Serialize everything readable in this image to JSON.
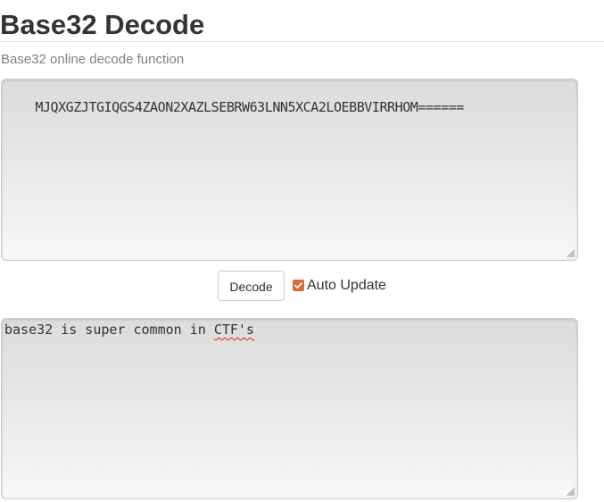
{
  "header": {
    "title": "Base32 Decode",
    "subtitle": "Base32 online decode function"
  },
  "input": {
    "value": "MJQXGZJTGIQGS4ZAON2XAZLSEBRW63LNN5XCA2LOEBBVIRRHOM======"
  },
  "controls": {
    "decode_label": "Decode",
    "auto_update_label": "Auto Update",
    "auto_update_checked": true
  },
  "output": {
    "prefix": "base32 is super common in ",
    "flagged_word": "CTF's"
  },
  "colors": {
    "checkbox": "#d9683c",
    "text": "#333333",
    "subtitle": "#808080"
  }
}
